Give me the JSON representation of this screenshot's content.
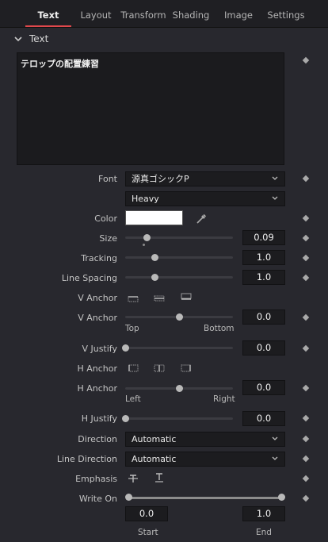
{
  "tabs": [
    {
      "label": "Text",
      "active": true
    },
    {
      "label": "Layout"
    },
    {
      "label": "Transform"
    },
    {
      "label": "Shading"
    },
    {
      "label": "Image"
    },
    {
      "label": "Settings"
    }
  ],
  "section": {
    "title": "Text"
  },
  "styled_text": "テロップの配置練習",
  "font": {
    "label": "Font",
    "family": "源真ゴシックP",
    "style": "Heavy"
  },
  "color": {
    "label": "Color",
    "value": "#ffffff"
  },
  "size": {
    "label": "Size",
    "value": "0.09",
    "level": 0.2
  },
  "tracking": {
    "label": "Tracking",
    "value": "1.0",
    "level": 0.27
  },
  "line_spacing": {
    "label": "Line Spacing",
    "value": "1.0",
    "level": 0.27
  },
  "v_anchor": {
    "label": "V Anchor",
    "slider_label": "V Anchor",
    "value": "0.0",
    "level": 0.5,
    "min_label": "Top",
    "max_label": "Bottom"
  },
  "v_justify": {
    "label": "V Justify",
    "value": "0.0",
    "level": 0.0
  },
  "h_anchor": {
    "label": "H Anchor",
    "slider_label": "H Anchor",
    "value": "0.0",
    "level": 0.5,
    "min_label": "Left",
    "max_label": "Right"
  },
  "h_justify": {
    "label": "H Justify",
    "value": "0.0",
    "level": 0.0
  },
  "direction": {
    "label": "Direction",
    "value": "Automatic"
  },
  "line_direction": {
    "label": "Line Direction",
    "value": "Automatic"
  },
  "emphasis": {
    "label": "Emphasis"
  },
  "write_on": {
    "label": "Write On",
    "start": "0.0",
    "end": "1.0",
    "start_label": "Start",
    "end_label": "End"
  },
  "colors": {
    "accent": "#e0484c",
    "background": "#28282e",
    "field": "#1c1c1f"
  }
}
